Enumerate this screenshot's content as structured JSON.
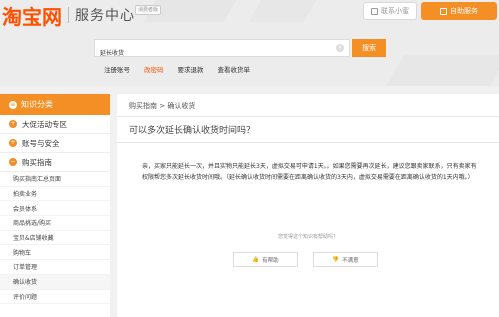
{
  "header": {
    "logo_main": "淘宝网",
    "logo_sub": "服务中心",
    "beta": "消费者版",
    "contact_label": "联系小蜜",
    "self_service_label": "自助服务",
    "search_value": "延长收货",
    "search_button": "搜索",
    "hot_links": [
      "注册账号",
      "改密码",
      "要求退款",
      "查看收货单"
    ]
  },
  "sidebar": {
    "head_label": "知识分类",
    "categories": [
      "大促活动专区",
      "账号与安全",
      "购买指南"
    ],
    "items": [
      "购买指南汇总页面",
      "拍卖业务",
      "会员体系",
      "商品挑选/购买",
      "宝贝&店铺收藏",
      "购物车",
      "订单管理",
      "确认收货",
      "评价问题"
    ],
    "active_index": 7
  },
  "main": {
    "breadcrumb": "购买指南 > 确认收货",
    "question": "可以多次延长确认收货时间吗？",
    "answer": "亲，买家只能延长一次，并且实物只能延长3天，虚拟交易可申请1天。。如果您需要再次延长，建议您跟卖家联系，只有卖家有权限帮您多次延长收货时间哦。（延长确认收货时间需要在距离确认收货的3天内，虚拟交易需要在距离确认收货的1天内哦。）",
    "helpful_prompt": "您觉得这个知识有帮助吗？",
    "vote_yes": "有帮助",
    "vote_no": "不满意"
  },
  "colors": {
    "brand_orange": "#ff5000",
    "accent_orange": "#f48f26"
  }
}
